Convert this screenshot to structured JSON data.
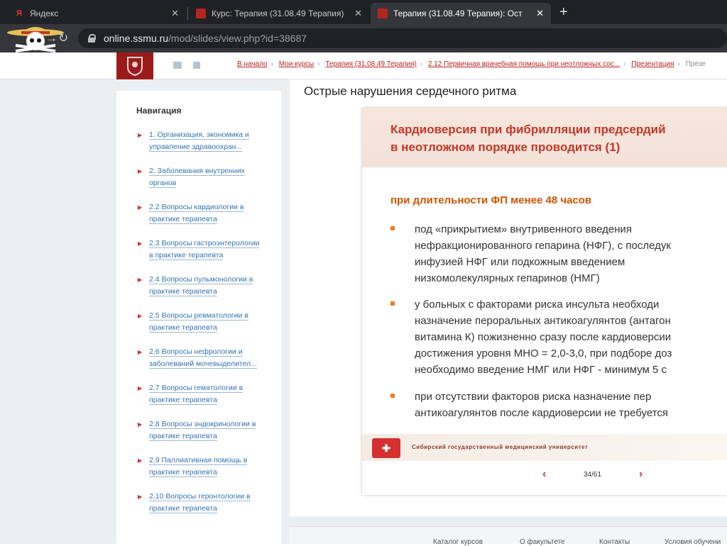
{
  "browser": {
    "tabs": [
      {
        "title": "Яндекс",
        "favicon": "Я"
      },
      {
        "title": "Курс: Терапия (31.08.49 Терапия)",
        "favicon": ""
      },
      {
        "title": "Терапия (31.08.49 Терапия): Ост",
        "favicon": ""
      }
    ],
    "url_host": "online.ssmu.ru",
    "url_path": "/mod/slides/view.php?id=38687"
  },
  "breadcrumb": [
    "В начало",
    "Мои курсы",
    "Терапия (31.08.49 Терапия)",
    "2.12 Первичная врачебная помощь при неотложных сос...",
    "Презентация",
    "Презе"
  ],
  "sidebar": {
    "title": "Навигация",
    "items": [
      "1. Организация, экономика и управление здравоохран...",
      "2. Заболевания внутренних органов",
      "2.2 Вопросы кардиологии в практике терапевта",
      "2.3 Вопросы гастроэнтерологии в практике терапевта",
      "2.4 Вопросы пульмонологии в практике терапевта",
      "2.5 Вопросы ревматологии в практике терапевта",
      "2.6 Вопросы нефрологии и заболеваний мочевыделител...",
      "2.7 Вопросы гематологии в практике терапевта",
      "2.8 Вопросы эндокринологии в практике терапевта",
      "2.9 Паллиативная помощь в практике терапевта",
      "2.10 Вопросы геронтологии в практике терапевта"
    ]
  },
  "main": {
    "title": "Острые нарушения сердечного ритма",
    "slide": {
      "heading": "Кардиоверсия при фибрилляции предсердий\nв неотложном порядке проводится (1)",
      "subheading": "при длительности  ФП менее 48 часов",
      "bullets": [
        "под «прикрытием» внутривенного введения\nнефракционированного гепарина (НФГ), с последук\nинфузией НФГ или подкожным введением\nнизкомолекулярных гепаринов (НМГ)",
        "у больных с факторами риска инсульта необходи\nназначение пероральных антикоагулянтов (антагон\nвитамина К) пожизненно сразу после кардиоверсии\nдостижения уровня МНО = 2,0-3,0, при подборе доз\nнеобходимо введение НМГ или НФГ - минимум 5 с",
        "при отсутствии факторов риска назначение пер\nантикоагулянтов после кардиоверсии не требуется"
      ],
      "footer_university": "Сибирский государственный медицинский университет"
    },
    "pager": "34/61"
  },
  "footer_links": [
    "Каталог курсов",
    "О факультете",
    "Контакты",
    "Условия обучени"
  ]
}
